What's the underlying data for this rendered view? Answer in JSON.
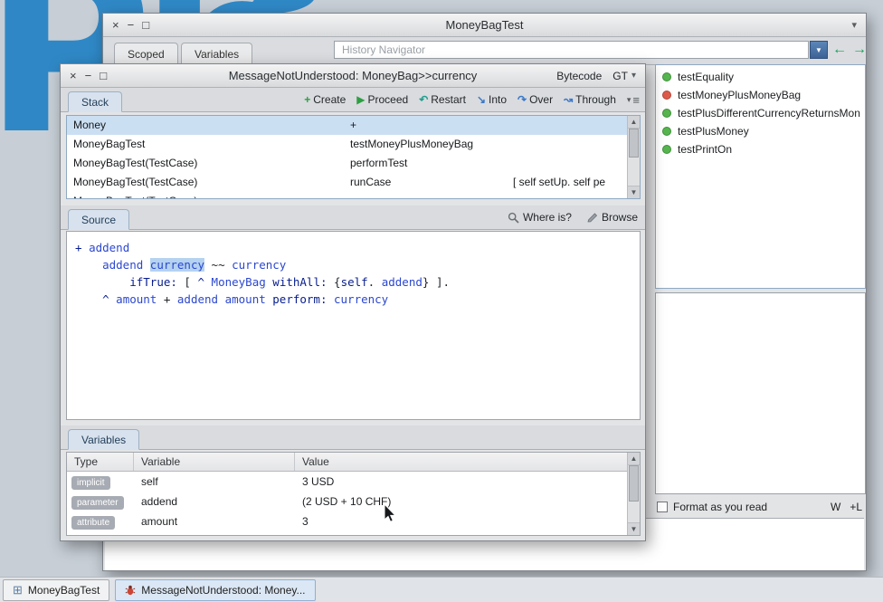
{
  "logo_text": "Ph",
  "colors": {
    "pharo_blue": "#2f88c5",
    "pass_green": "#56b54e",
    "fail_red": "#dd5a4a",
    "selection_blue": "#cbdff2",
    "code_keyword": "#071d8d",
    "code_identifier": "#2b47d0"
  },
  "scrollbar": {
    "up": "▲",
    "down": "▼"
  },
  "main_window": {
    "title": "MoneyBagTest",
    "controls": {
      "close": "×",
      "minimize": "−",
      "maximize": "□",
      "menu": "▾"
    },
    "tabs": [
      {
        "label": "Scoped"
      },
      {
        "label": "Variables"
      }
    ],
    "history_navigator": {
      "placeholder": "History Navigator",
      "dropdown_icon": "▼",
      "back_icon": "←",
      "forward_icon": "→"
    },
    "tests": [
      {
        "name": "testEquality",
        "status": "pass"
      },
      {
        "name": "testMoneyPlusMoneyBag",
        "status": "fail"
      },
      {
        "name": "testPlusDifferentCurrencyReturnsMon",
        "status": "pass"
      },
      {
        "name": "testPlusMoney",
        "status": "pass"
      },
      {
        "name": "testPrintOn",
        "status": "pass"
      }
    ],
    "format_row": {
      "checkbox_label": "Format as you read",
      "w_label": "W",
      "l_label": "+L"
    }
  },
  "debugger": {
    "title": "MessageNotUnderstood: MoneyBag>>currency",
    "controls": {
      "close": "×",
      "minimize": "−",
      "maximize": "□"
    },
    "bytecode_label": "Bytecode",
    "gt_label": "GT",
    "gt_caret": "▾",
    "stack": {
      "tab_label": "Stack",
      "toolbar": [
        {
          "icon": "+",
          "label": "Create"
        },
        {
          "icon": "▶",
          "label": "Proceed"
        },
        {
          "icon": "↶",
          "label": "Restart"
        },
        {
          "icon": "↘",
          "label": "Into"
        },
        {
          "icon": "↷",
          "label": "Over"
        },
        {
          "icon": "↝",
          "label": "Through"
        }
      ],
      "menu_caret": "▾",
      "menu_icon": "≡",
      "rows": [
        {
          "receiver": "Money",
          "method": "+",
          "context": "",
          "selected": true
        },
        {
          "receiver": "MoneyBagTest",
          "method": "testMoneyPlusMoneyBag",
          "context": "",
          "selected": false
        },
        {
          "receiver": "MoneyBagTest(TestCase)",
          "method": "performTest",
          "context": "",
          "selected": false
        },
        {
          "receiver": "MoneyBagTest(TestCase)",
          "method": "runCase",
          "context": "[ self setUp. self pe",
          "selected": false
        },
        {
          "receiver": "MoneyBagTest(TestCase)",
          "method": "",
          "context": "",
          "selected": false
        }
      ]
    },
    "source": {
      "tab_label": "Source",
      "where_is_label": "Where is?",
      "browse_label": "Browse",
      "code_lines": [
        [
          {
            "t": "+ ",
            "c": "kw"
          },
          {
            "t": "addend",
            "c": "id"
          }
        ],
        [
          {
            "t": "    ",
            "c": "pl"
          },
          {
            "t": "addend ",
            "c": "id"
          },
          {
            "t": "currency",
            "c": "id",
            "sel": true
          },
          {
            "t": " ~~ ",
            "c": "pl"
          },
          {
            "t": "currency",
            "c": "id"
          }
        ],
        [
          {
            "t": "        ",
            "c": "pl"
          },
          {
            "t": "ifTrue:",
            "c": "kw"
          },
          {
            "t": " [ ",
            "c": "pl"
          },
          {
            "t": "^ ",
            "c": "kw"
          },
          {
            "t": "MoneyBag",
            "c": "id"
          },
          {
            "t": " withAll:",
            "c": "kw"
          },
          {
            "t": " {",
            "c": "pl"
          },
          {
            "t": "self",
            "c": "kw"
          },
          {
            "t": ". ",
            "c": "pl"
          },
          {
            "t": "addend",
            "c": "id"
          },
          {
            "t": "}",
            "c": "pl"
          },
          {
            "t": " ].",
            "c": "pl"
          }
        ],
        [
          {
            "t": "    ",
            "c": "pl"
          },
          {
            "t": "^ ",
            "c": "kw"
          },
          {
            "t": "amount",
            "c": "id"
          },
          {
            "t": " + ",
            "c": "pl"
          },
          {
            "t": "addend amount ",
            "c": "id"
          },
          {
            "t": "perform: ",
            "c": "kw"
          },
          {
            "t": "currency",
            "c": "id"
          }
        ]
      ]
    },
    "variables": {
      "tab_label": "Variables",
      "headers": [
        "Type",
        "Variable",
        "Value"
      ],
      "rows": [
        {
          "type": "implicit",
          "variable": "self",
          "value": "3 USD"
        },
        {
          "type": "parameter",
          "variable": "addend",
          "value": "(2 USD + 10 CHF)"
        },
        {
          "type": "attribute",
          "variable": "amount",
          "value": "3"
        }
      ]
    }
  },
  "taskbar": {
    "items": [
      {
        "label": "MoneyBagTest",
        "glyph": "⊞",
        "active": false
      },
      {
        "label": "MessageNotUnderstood: Money...",
        "glyph": "",
        "active": true
      }
    ]
  }
}
